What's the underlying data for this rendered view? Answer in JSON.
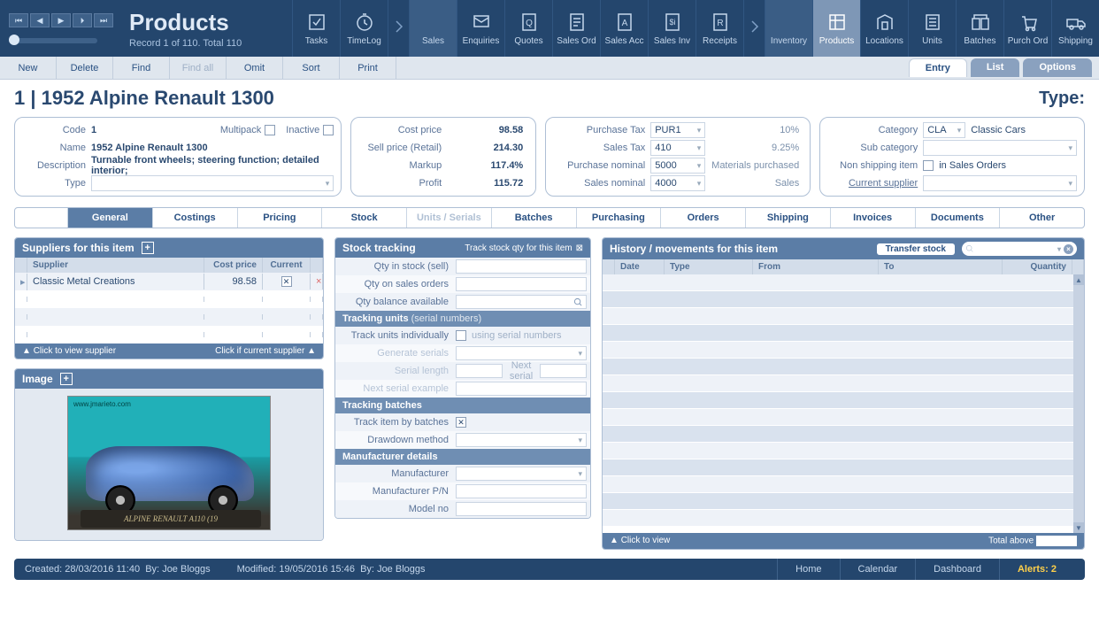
{
  "header": {
    "title": "Products",
    "record_info": "Record 1 of 110. Total 110",
    "type_label": "Type:"
  },
  "modules": [
    {
      "label": "Tasks"
    },
    {
      "label": "TimeLog"
    },
    {
      "label": "",
      "arrow": true
    },
    {
      "label": "Sales",
      "sub": true
    },
    {
      "label": "Enquiries"
    },
    {
      "label": "Quotes"
    },
    {
      "label": "Sales Ord"
    },
    {
      "label": "Sales Acc"
    },
    {
      "label": "Sales Inv"
    },
    {
      "label": "Receipts"
    },
    {
      "label": "",
      "arrow": true
    },
    {
      "label": "Inventory",
      "sub": true
    },
    {
      "label": "Products",
      "active": true
    },
    {
      "label": "Locations"
    },
    {
      "label": "Units"
    },
    {
      "label": "Batches"
    },
    {
      "label": "Purch Ord"
    },
    {
      "label": "Shipping"
    }
  ],
  "actions": {
    "new": "New",
    "delete": "Delete",
    "find": "Find",
    "find_all": "Find all",
    "omit": "Omit",
    "sort": "Sort",
    "print": "Print"
  },
  "right_tabs": {
    "entry": "Entry",
    "list": "List",
    "options": "Options"
  },
  "record": {
    "heading": "1 | 1952 Alpine Renault 1300",
    "code_label": "Code",
    "code": "1",
    "multipack_label": "Multipack",
    "inactive_label": "Inactive",
    "name_label": "Name",
    "name": "1952 Alpine Renault 1300",
    "desc_label": "Description",
    "description": "Turnable front wheels; steering function; detailed interior;",
    "type_label": "Type"
  },
  "pricing": {
    "cost_label": "Cost price",
    "cost": "98.58",
    "sell_label": "Sell price (Retail)",
    "sell": "214.30",
    "markup_label": "Markup",
    "markup": "117.4%",
    "profit_label": "Profit",
    "profit": "115.72"
  },
  "tax": {
    "ptax_label": "Purchase Tax",
    "ptax": "PUR1",
    "ptax_pct": "10%",
    "stax_label": "Sales Tax",
    "stax": "410",
    "stax_pct": "9.25%",
    "pnom_label": "Purchase nominal",
    "pnom": "5000",
    "pnom_desc": "Materials purchased",
    "snom_label": "Sales nominal",
    "snom": "4000",
    "snom_desc": "Sales"
  },
  "class": {
    "cat_label": "Category",
    "cat": "CLA",
    "cat_desc": "Classic Cars",
    "subcat_label": "Sub category",
    "nonship_label": "Non shipping item",
    "nonship_hint": "in Sales Orders",
    "cursup_label": "Current supplier"
  },
  "subtabs": [
    "General",
    "Costings",
    "Pricing",
    "Stock",
    "Units / Serials",
    "Batches",
    "Purchasing",
    "Orders",
    "Shipping",
    "Invoices",
    "Documents",
    "Other"
  ],
  "suppliers": {
    "title": "Suppliers for this item",
    "cols": {
      "supplier": "Supplier",
      "cost": "Cost price",
      "current": "Current"
    },
    "rows": [
      {
        "supplier": "Classic Metal Creations",
        "cost": "98.58",
        "current": true
      }
    ],
    "foot_left": "Click to view supplier",
    "foot_right": "Click if current supplier"
  },
  "image_panel": {
    "title": "Image",
    "base_text": "ALPINE RENAULT A110 (19",
    "url": "www.jmarieto.com"
  },
  "stock_tracking": {
    "title": "Stock tracking",
    "link": "Track stock qty for this item",
    "qty_stock": "Qty in stock (sell)",
    "qty_so": "Qty on sales orders",
    "qty_bal": "Qty balance available"
  },
  "tracking_units": {
    "title": "Tracking units",
    "title_suffix": "(serial numbers)",
    "track_ind": "Track units individually",
    "serial_hint": "using serial numbers",
    "gen": "Generate serials",
    "len": "Serial length",
    "next": "Next serial",
    "example": "Next serial example"
  },
  "tracking_batches": {
    "title": "Tracking batches",
    "by_batches": "Track item by batches",
    "drawdown": "Drawdown method"
  },
  "manufacturer": {
    "title": "Manufacturer details",
    "man": "Manufacturer",
    "pn": "Manufacturer P/N",
    "model": "Model no"
  },
  "history": {
    "title": "History / movements for this item",
    "transfer": "Transfer stock",
    "cols": {
      "date": "Date",
      "type": "Type",
      "from": "From",
      "to": "To",
      "qty": "Quantity"
    },
    "foot_left": "Click to view",
    "foot_right": "Total above"
  },
  "footer": {
    "created_label": "Created:",
    "created": "28/03/2016  11:40",
    "created_by_label": "By:",
    "created_by": "Joe Bloggs",
    "modified_label": "Modified:",
    "modified": "19/05/2016  15:46",
    "modified_by_label": "By:",
    "modified_by": "Joe Bloggs",
    "home": "Home",
    "calendar": "Calendar",
    "dashboard": "Dashboard",
    "alerts": "Alerts: 2"
  }
}
